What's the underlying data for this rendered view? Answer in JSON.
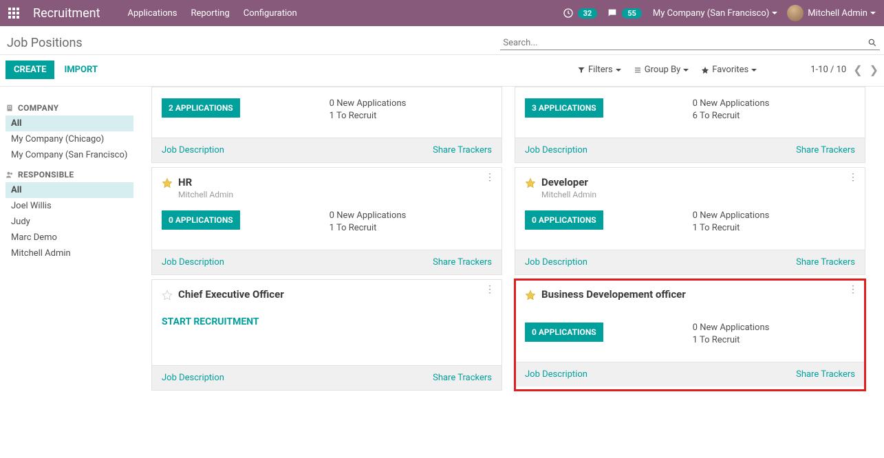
{
  "topbar": {
    "brand": "Recruitment",
    "menu": [
      "Applications",
      "Reporting",
      "Configuration"
    ],
    "clock_badge": "32",
    "chat_badge": "55",
    "company": "My Company (San Francisco)",
    "user": "Mitchell Admin"
  },
  "header": {
    "title": "Job Positions",
    "search_placeholder": "Search...",
    "create": "CREATE",
    "import": "IMPORT",
    "filters": "Filters",
    "groupby": "Group By",
    "favorites": "Favorites",
    "pager": "1-10 / 10"
  },
  "sidebar": {
    "company_heading": "COMPANY",
    "company_items": [
      "All",
      "My Company (Chicago)",
      "My Company (San Francisco)"
    ],
    "responsible_heading": "RESPONSIBLE",
    "responsible_items": [
      "All",
      "Joel Willis",
      "Judy",
      "Marc Demo",
      "Mitchell Admin"
    ]
  },
  "cards": {
    "row0": {
      "left": {
        "apps_btn": "2 APPLICATIONS",
        "new_apps": "0 New Applications",
        "to_recruit": "1 To Recruit",
        "job_desc": "Job Description",
        "share": "Share Trackers"
      },
      "right": {
        "apps_btn": "3 APPLICATIONS",
        "new_apps": "0 New Applications",
        "to_recruit": "6 To Recruit",
        "job_desc": "Job Description",
        "share": "Share Trackers"
      }
    },
    "row1": {
      "left": {
        "title": "HR",
        "sub": "Mitchell Admin",
        "apps_btn": "0 APPLICATIONS",
        "new_apps": "0 New Applications",
        "to_recruit": "1 To Recruit",
        "job_desc": "Job Description",
        "share": "Share Trackers"
      },
      "right": {
        "title": "Developer",
        "sub": "Mitchell Admin",
        "apps_btn": "0 APPLICATIONS",
        "new_apps": "0 New Applications",
        "to_recruit": "1 To Recruit",
        "job_desc": "Job Description",
        "share": "Share Trackers"
      }
    },
    "row2": {
      "left": {
        "title": "Chief Executive Officer",
        "start_btn": "START RECRUITMENT",
        "job_desc": "Job Description",
        "share": "Share Trackers"
      },
      "right": {
        "title": "Business Developement officer",
        "apps_btn": "0 APPLICATIONS",
        "new_apps": "0 New Applications",
        "to_recruit": "1 To Recruit",
        "job_desc": "Job Description",
        "share": "Share Trackers"
      }
    }
  }
}
